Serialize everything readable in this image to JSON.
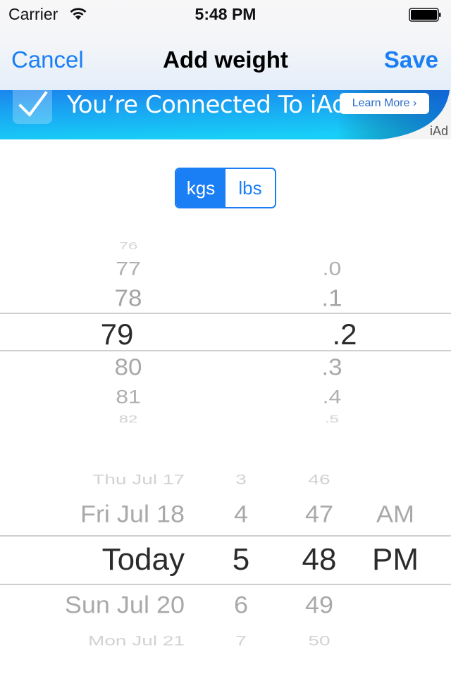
{
  "status_bar": {
    "carrier": "Carrier",
    "time": "5:48 PM",
    "wifi_icon": "wifi-icon",
    "battery_icon": "battery-full-icon"
  },
  "nav_bar": {
    "cancel_label": "Cancel",
    "title": "Add weight",
    "save_label": "Save"
  },
  "ad_banner": {
    "check_icon": "checkmark-icon",
    "text": "You’re Connected To iAd",
    "learn_more_label": "Learn More ›",
    "ad_label": "iAd"
  },
  "unit_selector": {
    "options": [
      {
        "label": "kgs",
        "selected": true
      },
      {
        "label": "lbs",
        "selected": false
      }
    ]
  },
  "weight_picker": {
    "whole_column": {
      "items": [
        "76",
        "77",
        "78",
        "79",
        "80",
        "81",
        "82"
      ],
      "selected": "79"
    },
    "decimal_column": {
      "items": [
        ".0",
        ".1",
        ".2",
        ".3",
        ".4",
        ".5"
      ],
      "selected": ".2"
    }
  },
  "date_picker": {
    "day_column": {
      "items": [
        "Thu Jul 17",
        "Fri Jul 18",
        "Today",
        "Sun Jul 20",
        "Mon Jul 21"
      ],
      "selected": "Today"
    },
    "hour_column": {
      "items": [
        "3",
        "4",
        "5",
        "6",
        "7"
      ],
      "selected": "5"
    },
    "minute_column": {
      "items": [
        "46",
        "47",
        "48",
        "49",
        "50"
      ],
      "selected": "48"
    },
    "period_column": {
      "items": [
        "AM",
        "PM"
      ],
      "selected": "PM"
    }
  },
  "colors": {
    "accent": "#1a7ff4",
    "selected_text": "#2b2b2b",
    "unselected_text": "#a9a9a9",
    "separator": "#cfcfcf"
  }
}
